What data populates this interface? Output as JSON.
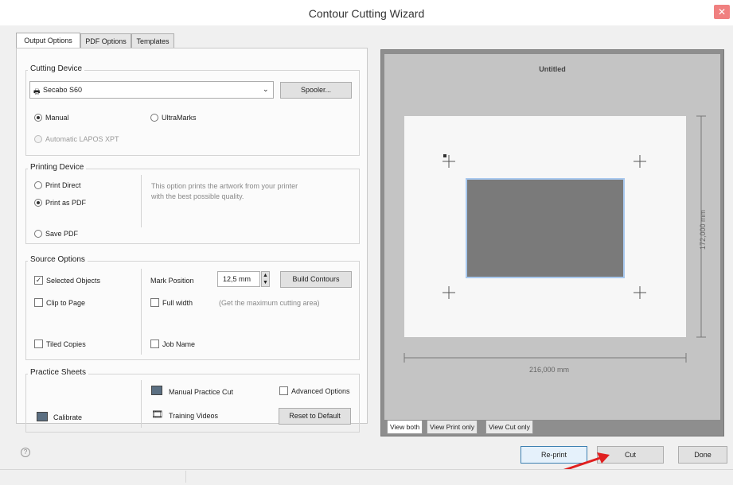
{
  "window": {
    "title": "Contour Cutting Wizard",
    "close_label": "✕"
  },
  "tabs": [
    "Output Options",
    "PDF Options",
    "Templates"
  ],
  "cutting_device": {
    "group_label": "Cutting Device",
    "device": "Secabo S60",
    "spooler_label": "Spooler...",
    "manual_label": "Manual",
    "ultramarks_label": "UltraMarks",
    "laposxpt_label": "Automatic LAPOS XPT"
  },
  "printing_device": {
    "group_label": "Printing Device",
    "print_direct_label": "Print Direct",
    "print_pdf_label": "Print as PDF",
    "save_pdf_label": "Save PDF",
    "description": "This option prints the artwork from your printer with the best possible quality."
  },
  "source_options": {
    "group_label": "Source Options",
    "selected_objects_label": "Selected Objects",
    "clip_to_page_label": "Clip to Page",
    "tiled_copies_label": "Tiled Copies",
    "mark_position_label": "Mark Position",
    "mark_position_value": "12,5 mm",
    "build_contours_label": "Build Contours",
    "full_width_label": "Full width",
    "full_width_hint": "(Get the maximum cutting area)",
    "job_name_label": "Job Name"
  },
  "practice_sheets": {
    "group_label": "Practice Sheets",
    "manual_practice_label": "Manual Practice Cut",
    "advanced_options_label": "Advanced Options",
    "calibrate_label": "Calibrate",
    "training_videos_label": "Training Videos",
    "reset_default_label": "Reset to Default"
  },
  "preview": {
    "doc_title": "Untitled",
    "width_label": "216,000 mm",
    "height_label": "172,000 mm",
    "view_tabs": [
      "View both",
      "View Print only",
      "View Cut only"
    ]
  },
  "footer": {
    "help_label": "?",
    "reprint_label": "Re-print",
    "cut_label": "Cut",
    "done_label": "Done"
  },
  "colors": {
    "annotation_arrow": "#e02020",
    "artwork": "#7a7a7a"
  }
}
